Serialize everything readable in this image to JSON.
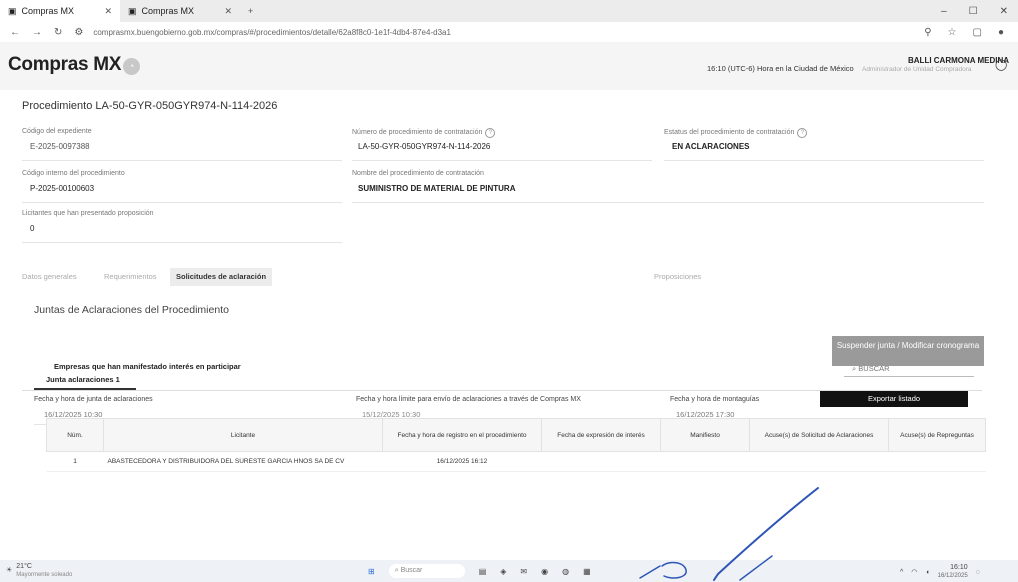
{
  "browser": {
    "tabs": [
      {
        "label": "Compras MX",
        "active": true
      },
      {
        "label": "Compras MX",
        "active": false
      }
    ],
    "new_tab": "+",
    "url": "comprasmx.buengobierno.gob.mx/compras/#/procedimientos/detalle/62a8f8c0-1e1f-4db4-87e4-d3a1"
  },
  "header": {
    "brand": "Compras MX",
    "clock": "16:10 (UTC-6) Hora en la Ciudad de México",
    "user_name": "BALLI CARMONA MEDINA",
    "user_role": "Administrador de Unidad Compradora"
  },
  "procedure": {
    "title": "Procedimiento LA-50-GYR-050GYR974-N-114-2026",
    "fields": {
      "expediente_label": "Código del expediente",
      "expediente_value": "E-2025-0097388",
      "numero_label": "Número de procedimiento de contratación",
      "numero_value": "LA-50-GYR-050GYR974-N-114-2026",
      "estatus_label": "Estatus del procedimiento de contratación",
      "estatus_value": "EN ACLARACIONES",
      "codigo_interno_label": "Código interno del procedimiento",
      "codigo_interno_value": "P-2025-00100603",
      "nombre_label": "Nombre del procedimiento de contratación",
      "nombre_value": "SUMINISTRO DE MATERIAL DE PINTURA",
      "licitantes_label": "Licitantes que han presentado proposición",
      "licitantes_value": "0"
    }
  },
  "tabs": [
    {
      "label": "Datos generales",
      "active": false
    },
    {
      "label": "Requerimientos",
      "active": false
    },
    {
      "label": "Solicitudes de aclaración",
      "active": true
    },
    {
      "label": "Proposiciones",
      "active": false
    }
  ],
  "juntas": {
    "section_title": "Juntas de Aclaraciones del Procedimiento",
    "suspend_button": "Suspender junta / Modificar cronograma",
    "junta_tab": "Junta aclaraciones 1",
    "fecha_junta_label": "Fecha y hora de junta de aclaraciones",
    "fecha_junta_value": "16/12/2025 10:30",
    "fecha_envio_label": "Fecha y hora límite para envío de aclaraciones a través de Compras MX",
    "fecha_envio_value": "15/12/2025 10:30",
    "fecha_monto_label": "Fecha y hora de montaguías",
    "fecha_monto_value": "16/12/2025 17:30"
  },
  "empresas": {
    "subtitle": "Empresas que han manifestado interés en participar",
    "search_placeholder": "BUSCAR",
    "export_button": "Exportar listado",
    "columns": [
      "Núm.",
      "Licitante",
      "Fecha y hora de registro en el procedimiento",
      "Fecha de expresión de interés",
      "Manifiesto",
      "Acuse(s) de Solicitud de Aclaraciones",
      "Acuse(s) de Repreguntas"
    ],
    "rows": [
      {
        "num": "1",
        "licitante": "ABASTECEDORA Y DISTRIBUIDORA DEL SURESTE GARCIA HNOS SA DE CV",
        "registro": "16/12/2025 16:12",
        "interes": "",
        "manifiesto": "",
        "acuse_solicitud": "",
        "acuse_repreguntas": ""
      }
    ]
  },
  "taskbar": {
    "weather_temp": "21°C",
    "weather_desc": "Mayormente soleado",
    "search": "Buscar",
    "time": "16:10",
    "date": "16/12/2025"
  },
  "colors": {
    "suspend_button_bg": "#9a9a9a",
    "export_button_bg": "#111111",
    "annotation_pen": "#2d55b5"
  }
}
